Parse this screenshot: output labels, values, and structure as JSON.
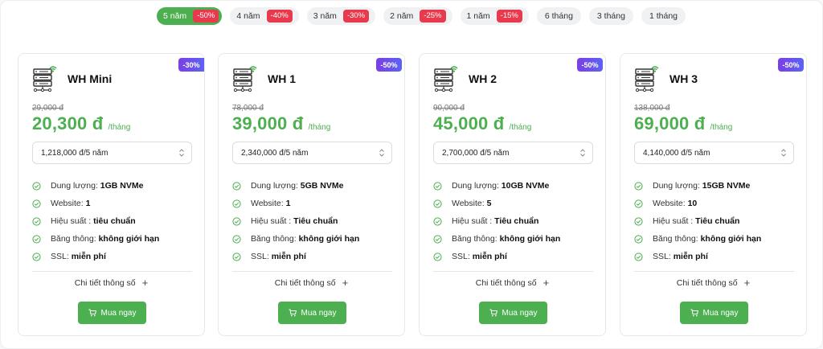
{
  "tabs": [
    {
      "label": "5 năm",
      "badge": "-50%"
    },
    {
      "label": "4 năm",
      "badge": "-40%"
    },
    {
      "label": "3 năm",
      "badge": "-30%"
    },
    {
      "label": "2 năm",
      "badge": "-25%"
    },
    {
      "label": "1 năm",
      "badge": "-15%"
    },
    {
      "label": "6 tháng"
    },
    {
      "label": "3 tháng"
    },
    {
      "label": "1 tháng"
    }
  ],
  "labels": {
    "per_month": "/tháng",
    "storage": "Dung lượng:",
    "website": "Website:",
    "performance": "Hiệu suất :",
    "bandwidth": "Băng thông:",
    "ssl": "SSL:",
    "details": "Chi tiết thông số",
    "buy": "Mua ngay"
  },
  "plans": [
    {
      "discount": "-30%",
      "name": "WH Mini",
      "old_price": "29,000 đ",
      "price": "20,300 đ",
      "term_select": "1,218,000 đ/5 năm",
      "storage": "1GB NVMe",
      "website": "1",
      "performance": "tiêu chuẩn",
      "bandwidth": "không giới hạn",
      "ssl": "miễn phí"
    },
    {
      "discount": "-50%",
      "name": "WH 1",
      "old_price": "78,000 đ",
      "price": "39,000 đ",
      "term_select": "2,340,000 đ/5 năm",
      "storage": "5GB NVMe",
      "website": "1",
      "performance": "Tiêu chuẩn",
      "bandwidth": "không giới hạn",
      "ssl": "miễn phí"
    },
    {
      "discount": "-50%",
      "name": "WH 2",
      "old_price": "90,000 đ",
      "price": "45,000 đ",
      "term_select": "2,700,000 đ/5 năm",
      "storage": "10GB NVMe",
      "website": "5",
      "performance": "Tiêu chuẩn",
      "bandwidth": "không giới hạn",
      "ssl": "miễn phí"
    },
    {
      "discount": "-50%",
      "name": "WH 3",
      "old_price": "138,000 đ",
      "price": "69,000 đ",
      "term_select": "4,140,000 đ/5 năm",
      "storage": "15GB NVMe",
      "website": "10",
      "performance": "Tiêu chuẩn",
      "bandwidth": "không giới hạn",
      "ssl": "miễn phí"
    }
  ],
  "colors": {
    "accent": "#4caf50",
    "badge_red": "#e8394d",
    "corner_purple": "#6c4bec"
  },
  "icons": {
    "plan": "server-wifi-icon",
    "feature": "check-circle-icon",
    "select": "chevron-updown-icon",
    "details": "plus-icon",
    "buy": "cart-icon"
  }
}
